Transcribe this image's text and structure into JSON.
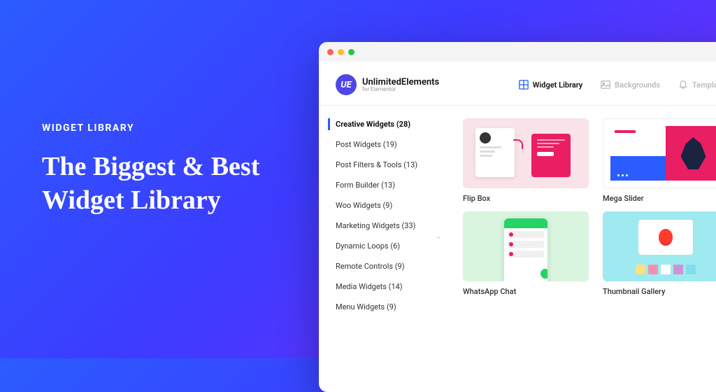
{
  "hero": {
    "eyebrow": "WIDGET LIBRARY",
    "headline": "The Biggest & Best Widget Library"
  },
  "brand": {
    "name": "UnlimitedElements",
    "sub": "for Elementor",
    "badge": "UE"
  },
  "tabs": [
    {
      "label": "Widget Library",
      "active": true
    },
    {
      "label": "Backgrounds",
      "active": false
    },
    {
      "label": "Templates",
      "active": false
    }
  ],
  "categories": [
    {
      "label": "Creative Widgets (28)",
      "active": true
    },
    {
      "label": "Post Widgets (19)"
    },
    {
      "label": "Post Filters & Tools (13)"
    },
    {
      "label": "Form Builder (13)"
    },
    {
      "label": "Woo Widgets (9)"
    },
    {
      "label": "Marketing Widgets (33)"
    },
    {
      "label": "Dynamic Loops (6)"
    },
    {
      "label": "Remote Controls (9)"
    },
    {
      "label": "Media Widgets (14)"
    },
    {
      "label": "Menu Widgets (9)"
    }
  ],
  "widgets": [
    {
      "title": "Flip Box"
    },
    {
      "title": "Mega Slider"
    },
    {
      "title": "WhatsApp Chat"
    },
    {
      "title": "Thumbnail Gallery"
    }
  ]
}
